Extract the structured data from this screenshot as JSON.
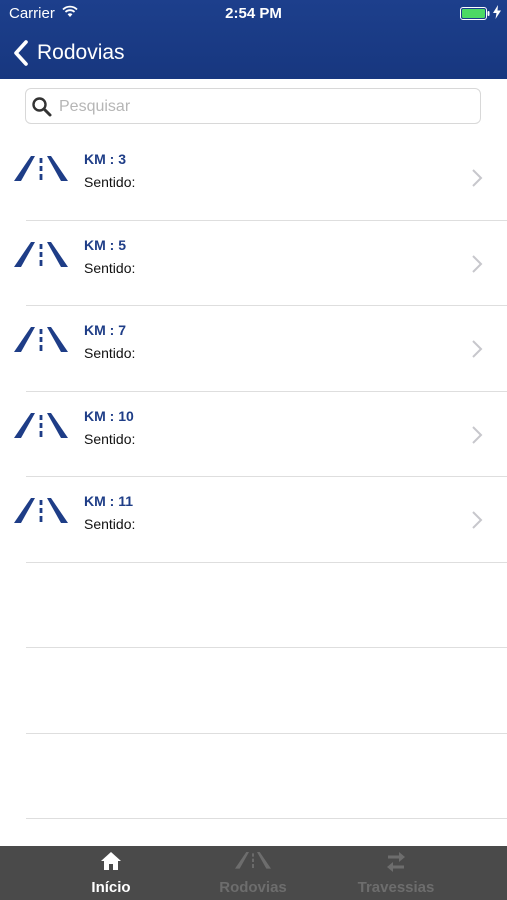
{
  "status_bar": {
    "carrier": "Carrier",
    "time": "2:54 PM"
  },
  "nav": {
    "back_label": "Rodovias"
  },
  "search": {
    "placeholder": "Pesquisar"
  },
  "list": {
    "items": [
      {
        "km": "KM : 3",
        "sentido": "Sentido:"
      },
      {
        "km": "KM : 5",
        "sentido": "Sentido:"
      },
      {
        "km": "KM : 7",
        "sentido": "Sentido:"
      },
      {
        "km": "KM : 10",
        "sentido": "Sentido:"
      },
      {
        "km": "KM : 11",
        "sentido": "Sentido:"
      }
    ]
  },
  "tabs": [
    {
      "label": "Início",
      "icon": "home-icon",
      "active": true
    },
    {
      "label": "Rodovias",
      "icon": "road-icon",
      "active": false
    },
    {
      "label": "Travessias",
      "icon": "swap-arrows-icon",
      "active": false
    }
  ],
  "colors": {
    "header": "#1d3f8c",
    "accent": "#1e3d87",
    "tab_bar": "#4a4a4a",
    "battery": "#4cd964"
  }
}
